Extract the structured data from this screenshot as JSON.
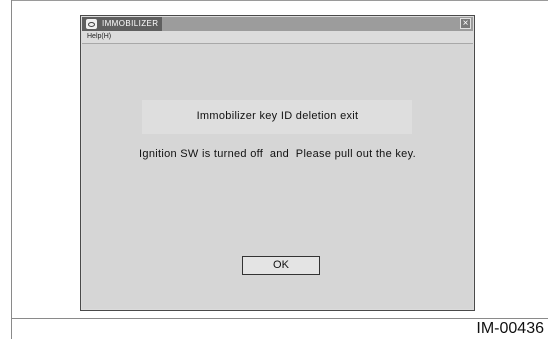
{
  "window": {
    "title": "IMMOBILIZER",
    "close_glyph": "×",
    "icon": "app-icon"
  },
  "menu": {
    "help_label": "Help(H)"
  },
  "dialog": {
    "message_title": "Immobilizer key ID deletion exit",
    "message_body": "Ignition SW is turned off  and  Please pull out the key.",
    "ok_label": "OK"
  },
  "figure": {
    "id": "IM-00436"
  }
}
